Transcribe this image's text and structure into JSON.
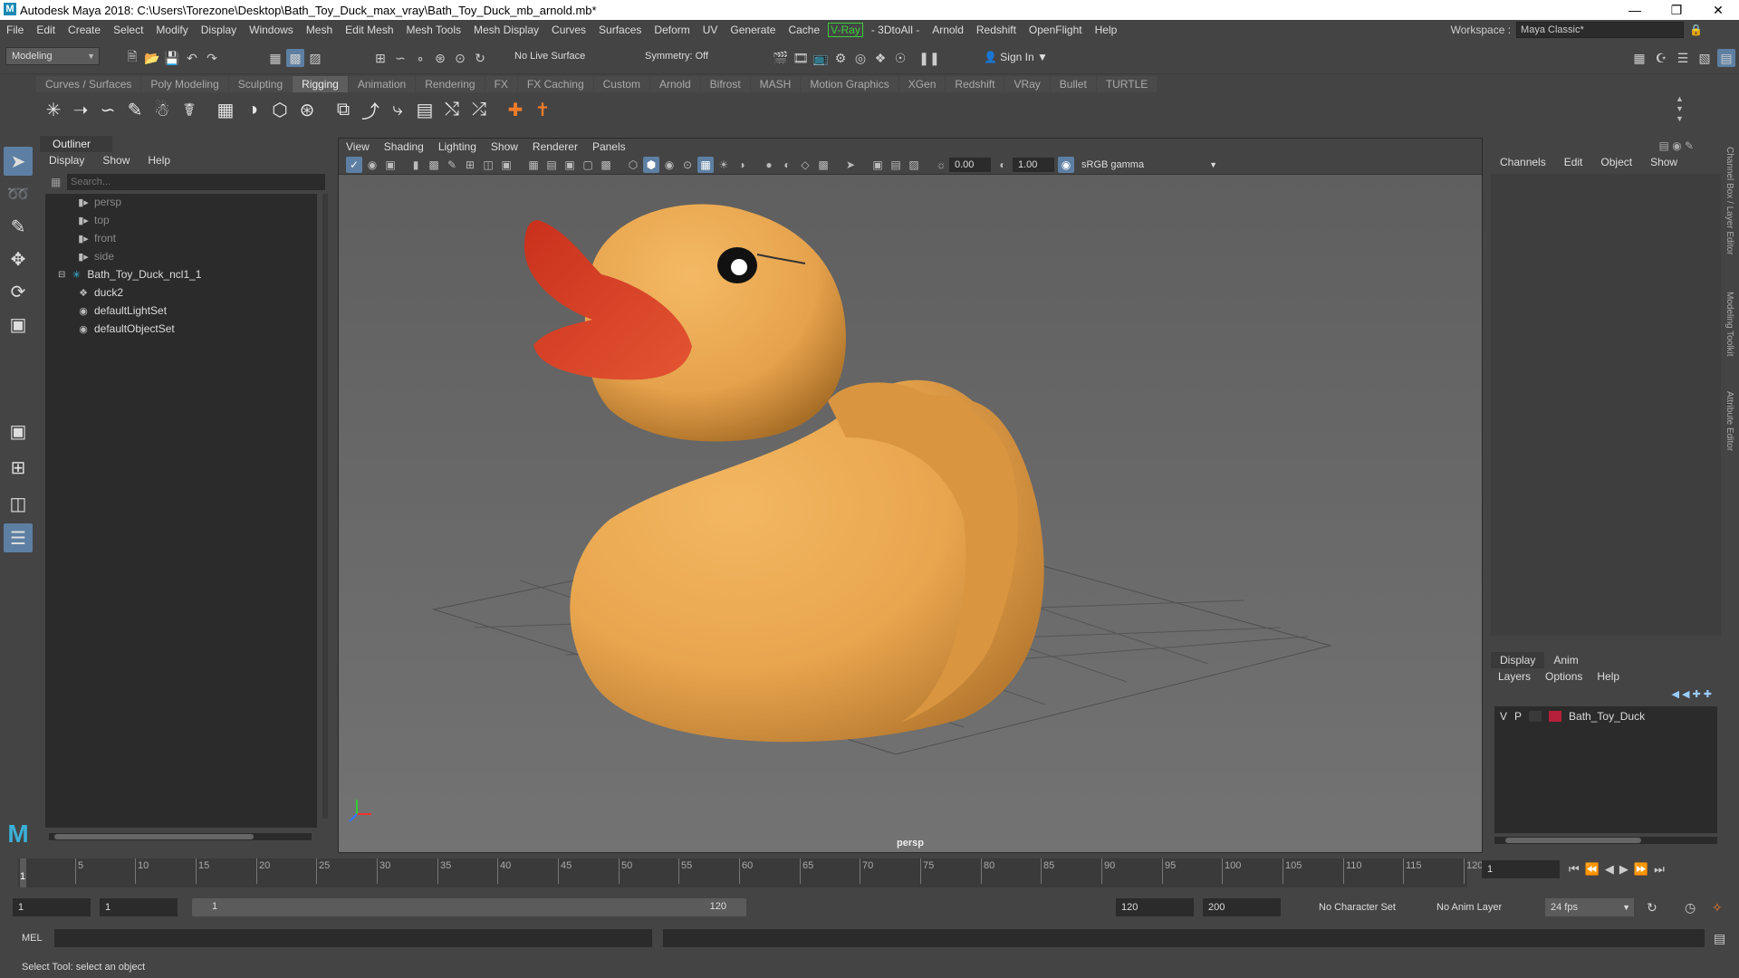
{
  "titlebar": {
    "title": "Autodesk Maya 2018: C:\\Users\\Torezone\\Desktop\\Bath_Toy_Duck_max_vray\\Bath_Toy_Duck_mb_arnold.mb*",
    "logo": "M"
  },
  "menubar": {
    "items": [
      "File",
      "Edit",
      "Create",
      "Select",
      "Modify",
      "Display",
      "Windows",
      "Mesh",
      "Edit Mesh",
      "Mesh Tools",
      "Mesh Display",
      "Curves",
      "Surfaces",
      "Deform",
      "UV",
      "Generate",
      "Cache"
    ],
    "vray": "V-Ray",
    "items2": [
      "- 3DtoAll -",
      "Arnold",
      "Redshift",
      "OpenFlight",
      "Help"
    ],
    "workspace_label": "Workspace :",
    "workspace_value": "Maya Classic*"
  },
  "statusline": {
    "menuset": "Modeling",
    "live_surface": "No Live Surface",
    "symmetry": "Symmetry: Off",
    "sign_in": "Sign In"
  },
  "shelf": {
    "tabs": [
      "Curves / Surfaces",
      "Poly Modeling",
      "Sculpting",
      "Rigging",
      "Animation",
      "Rendering",
      "FX",
      "FX Caching",
      "Custom",
      "Arnold",
      "Bifrost",
      "MASH",
      "Motion Graphics",
      "XGen",
      "Redshift",
      "VRay",
      "Bullet",
      "TURTLE"
    ],
    "active_tab": "Rigging"
  },
  "outliner": {
    "title": "Outliner",
    "menu": [
      "Display",
      "Show",
      "Help"
    ],
    "search_placeholder": "Search...",
    "items": [
      {
        "label": "persp",
        "icon": "camera-icon"
      },
      {
        "label": "top",
        "icon": "camera-icon"
      },
      {
        "label": "front",
        "icon": "camera-icon"
      },
      {
        "label": "side",
        "icon": "camera-icon"
      },
      {
        "label": "Bath_Toy_Duck_ncl1_1",
        "icon": "joint-icon"
      },
      {
        "label": "duck2",
        "icon": "mesh-icon"
      },
      {
        "label": "defaultLightSet",
        "icon": "set-icon"
      },
      {
        "label": "defaultObjectSet",
        "icon": "set-icon"
      }
    ]
  },
  "viewport": {
    "menu": [
      "View",
      "Shading",
      "Lighting",
      "Show",
      "Renderer",
      "Panels"
    ],
    "exposure": "0.00",
    "gamma": "1.00",
    "colorspace": "sRGB gamma",
    "camera": "persp"
  },
  "channelbox": {
    "menu": [
      "Channels",
      "Edit",
      "Object",
      "Show"
    ]
  },
  "side_tabs": [
    "Channel Box / Layer Editor",
    "Modeling Toolkit",
    "Attribute Editor"
  ],
  "layer_editor": {
    "tabs": [
      "Display",
      "Anim"
    ],
    "menu": [
      "Layers",
      "Options",
      "Help"
    ],
    "layer": {
      "v": "V",
      "p": "P",
      "name": "Bath_Toy_Duck",
      "color": "#b6203a"
    }
  },
  "timeslider": {
    "labels": [
      "5",
      "10",
      "15",
      "20",
      "25",
      "30",
      "35",
      "40",
      "45",
      "50",
      "55",
      "60",
      "65",
      "70",
      "75",
      "80",
      "85",
      "90",
      "95",
      "100",
      "105",
      "110",
      "115",
      "120"
    ],
    "current": "1",
    "current_field": "1"
  },
  "rangeslider": {
    "start": "1",
    "start2": "1",
    "range_start": "1",
    "range_end": "120",
    "end": "120",
    "end2": "200",
    "character_set": "No Character Set",
    "anim_layer": "No Anim Layer",
    "fps": "24 fps"
  },
  "cmdline": {
    "label": "MEL"
  },
  "helpline": {
    "text": "Select Tool: select an object"
  },
  "colors": {
    "accent": "#5d7fa3",
    "duck_body": "#e8a54e",
    "duck_beak": "#d9452b",
    "vray": "#3bd13b",
    "maya_logo": "#1a8ab4"
  }
}
